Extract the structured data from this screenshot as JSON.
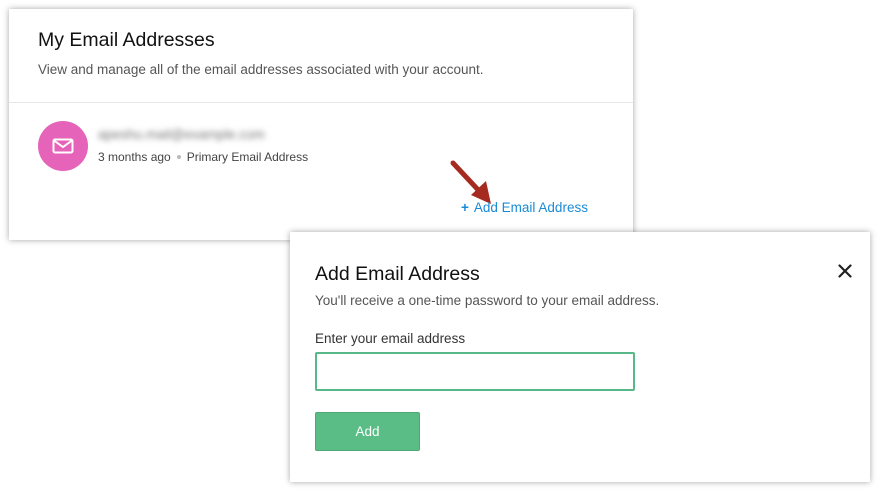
{
  "accounts_card": {
    "title": "My Email Addresses",
    "subtitle": "View and manage all of the email addresses associated with your account.",
    "email_item": {
      "avatar_icon": "mail-icon",
      "avatar_color": "#e563b8",
      "email": "apeshu.mail@example.com",
      "added": "3 months ago",
      "tag": "Primary Email Address"
    },
    "add_link_label": "Add Email Address",
    "add_link_color": "#1a8bd6",
    "annotation_arrow_color": "#a52a1f"
  },
  "dialog": {
    "title": "Add Email Address",
    "subtitle": "You'll receive a one-time password to your email address.",
    "close_icon": "close-icon",
    "field_label": "Enter your email address",
    "field_value": "",
    "field_placeholder": "",
    "submit_label": "Add",
    "submit_color": "#5abd86"
  }
}
